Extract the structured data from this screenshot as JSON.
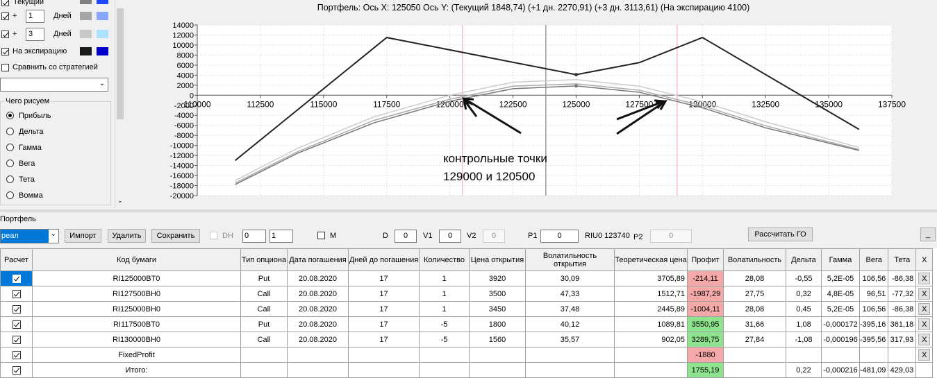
{
  "left_panel": {
    "rows": [
      {
        "label": "Текущий",
        "checked": true
      },
      {
        "prefix": "+",
        "days_value": "1",
        "days_label": "Дней",
        "checked": true
      },
      {
        "prefix": "+",
        "days_value": "3",
        "days_label": "Дней",
        "checked": true
      },
      {
        "label": "На экспирацию",
        "checked": true
      }
    ],
    "compare_label": "Сравнить со стратегией",
    "draw_group_title": "Чего рисуем",
    "draw_options": [
      "Прибыль",
      "Дельта",
      "Гамма",
      "Вега",
      "Тета",
      "Вомма"
    ],
    "draw_selected": "Прибыль"
  },
  "chart_data": {
    "type": "line",
    "title": "Портфель: Ось X: 125050 Ось Y:  (Текущий 1848,74)  (+1 дн. 2270,91)  (+3 дн. 3113,61)  (На экспирацию 4100)",
    "x_ticks": [
      110000,
      112500,
      115000,
      117500,
      120000,
      122500,
      125000,
      127500,
      130000,
      132500,
      135000,
      137500
    ],
    "y_ticks": [
      14000,
      12000,
      10000,
      8000,
      6000,
      4000,
      2000,
      0,
      -2000,
      -4000,
      -6000,
      -8000,
      -10000,
      -12000,
      -14000,
      -16000,
      -18000,
      -20000
    ],
    "xlim": [
      110000,
      137500
    ],
    "ylim": [
      -20000,
      14000
    ],
    "cursor_x": 123800,
    "marker_lines": [
      120500,
      129000
    ],
    "series": [
      {
        "name": "На экспирацию",
        "color": "#222222",
        "x": [
          111500,
          117500,
          125000,
          127500,
          130000,
          136200
        ],
        "y": [
          -13000,
          11500,
          4100,
          6500,
          11500,
          -6800
        ]
      },
      {
        "name": "Текущий",
        "color": "#777777",
        "x": [
          111500,
          114000,
          117000,
          120000,
          122500,
          125000,
          127500,
          130000,
          132500,
          136200
        ],
        "y": [
          -17800,
          -11500,
          -5500,
          -1200,
          1300,
          1850,
          600,
          -2500,
          -6500,
          -11000
        ]
      },
      {
        "name": "+1 дн.",
        "color": "#aaaaaa",
        "x": [
          111500,
          114000,
          117000,
          120000,
          122500,
          125000,
          127500,
          130000,
          132500,
          136200
        ],
        "y": [
          -17500,
          -11200,
          -5000,
          -800,
          1800,
          2270,
          1000,
          -2100,
          -6100,
          -10800
        ]
      },
      {
        "name": "+3 дн.",
        "color": "#cccccc",
        "x": [
          111500,
          114000,
          117000,
          120000,
          122500,
          125000,
          127500,
          130000,
          132500,
          136200
        ],
        "y": [
          -17000,
          -10500,
          -4300,
          0,
          2600,
          3113,
          1800,
          -1300,
          -5300,
          -10400
        ]
      }
    ],
    "annotation": [
      "контрольные точки",
      "129000 и 120500"
    ]
  },
  "portfolio_label": "Портфель",
  "toolbar": {
    "portfolio_select": "реал",
    "import_label": "Импорт",
    "delete_label": "Удалить",
    "save_label": "Сохранить",
    "dh_label": "DH",
    "spin1": "0",
    "spin2": "1",
    "m_label": "M",
    "d_label": "D",
    "d_value": "0",
    "v1_label": "V1",
    "v1_value": "0",
    "v2_label": "V2",
    "v2_value": "0",
    "p1_label": "P1",
    "p1_value": "0",
    "riu_label": "RIU0 123740",
    "p2_label": "P2",
    "p2_value": "0",
    "calc_label": "Рассчитать ГО",
    "min_label": "_"
  },
  "grid": {
    "headers": [
      "Расчет",
      "Код бумаги",
      "Тип опциона",
      "Дата погашения",
      "Дней до погашения",
      "Количество",
      "Цена открытия",
      "Волатильность открытия",
      "Теоретическая цена",
      "Профит",
      "Волатильность",
      "Дельта",
      "Гамма",
      "Вега",
      "Тета",
      "X"
    ],
    "rows": [
      {
        "code": "RI125000BT0",
        "type": "Put",
        "date": "20.08.2020",
        "days": "17",
        "qty": "1",
        "price": "3920",
        "vol_open": "30,09",
        "theo": "3705,89",
        "profit": "-214,11",
        "profit_color": "red",
        "vol": "28,08",
        "delta": "-0,55",
        "gamma": "5,2E-05",
        "vega": "106,56",
        "theta": "-86,38",
        "x": "X"
      },
      {
        "code": "RI127500BH0",
        "type": "Call",
        "date": "20.08.2020",
        "days": "17",
        "qty": "1",
        "price": "3500",
        "vol_open": "47,33",
        "theo": "1512,71",
        "profit": "-1987,29",
        "profit_color": "red",
        "vol": "27,75",
        "delta": "0,32",
        "gamma": "4,8E-05",
        "vega": "96,51",
        "theta": "-77,32",
        "x": "X"
      },
      {
        "code": "RI125000BH0",
        "type": "Call",
        "date": "20.08.2020",
        "days": "17",
        "qty": "1",
        "price": "3450",
        "vol_open": "37,48",
        "theo": "2445,89",
        "profit": "-1004,11",
        "profit_color": "red",
        "vol": "28,08",
        "delta": "0,45",
        "gamma": "5,2E-05",
        "vega": "106,56",
        "theta": "-86,38",
        "x": "X"
      },
      {
        "code": "RI117500BT0",
        "type": "Put",
        "date": "20.08.2020",
        "days": "17",
        "qty": "-5",
        "price": "1800",
        "vol_open": "40,12",
        "theo": "1089,81",
        "profit": "3550,95",
        "profit_color": "green",
        "vol": "31,66",
        "delta": "1,08",
        "gamma": "-0,000172",
        "vega": "-395,16",
        "theta": "361,18",
        "x": "X"
      },
      {
        "code": "RI130000BH0",
        "type": "Call",
        "date": "20.08.2020",
        "days": "17",
        "qty": "-5",
        "price": "1560",
        "vol_open": "35,57",
        "theo": "902,05",
        "profit": "3289,75",
        "profit_color": "green",
        "vol": "27,84",
        "delta": "-1,08",
        "gamma": "-0,000196",
        "vega": "-395,56",
        "theta": "317,93",
        "x": "X"
      },
      {
        "code": "FixedProfit",
        "type": "",
        "date": "",
        "days": "",
        "qty": "",
        "price": "",
        "vol_open": "",
        "theo": "",
        "profit": "-1880",
        "profit_color": "red",
        "vol": "",
        "delta": "",
        "gamma": "",
        "vega": "",
        "theta": "",
        "x": "X"
      },
      {
        "code": "Итого:",
        "type": "",
        "date": "",
        "days": "",
        "qty": "",
        "price": "",
        "vol_open": "",
        "theo": "",
        "profit": "1755,19",
        "profit_color": "green",
        "vol": "",
        "delta": "0,22",
        "gamma": "-0,000216",
        "vega": "-481,09",
        "theta": "429,03",
        "x": ""
      }
    ]
  }
}
